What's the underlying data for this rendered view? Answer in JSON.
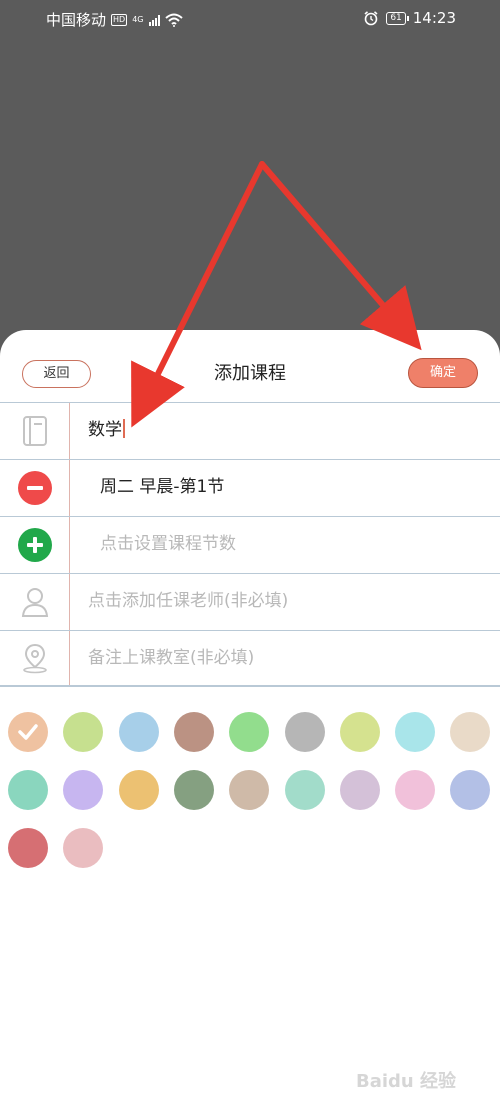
{
  "status_bar": {
    "carrier": "中国移动",
    "hd": "HD",
    "network": "4G",
    "battery": "61",
    "time": "14:23"
  },
  "header": {
    "back_label": "返回",
    "title": "添加课程",
    "confirm_label": "确定"
  },
  "form": {
    "course_name": "数学",
    "slot": "周二  早晨-第1节",
    "add_slot_placeholder": "点击设置课程节数",
    "teacher_placeholder": "点击添加任课老师(非必填)",
    "classroom_placeholder": "备注上课教室(非必填)"
  },
  "colors": {
    "accent": "#ef8069",
    "selected_index": 0,
    "swatches": [
      "#efc2a1",
      "#c6e08f",
      "#a7cfe9",
      "#bb9283",
      "#92dd8d",
      "#b6b6b6",
      "#d5e28f",
      "#a9e5ea",
      "#e9dac8",
      "#8ad6be",
      "#c7b6f0",
      "#ecc172",
      "#85a081",
      "#cfbaa8",
      "#a2dcca",
      "#d4c1d8",
      "#f1c1da",
      "#b3c0e6",
      "#d66f73",
      "#eabdc0"
    ]
  },
  "watermark": "Baidu 经验"
}
